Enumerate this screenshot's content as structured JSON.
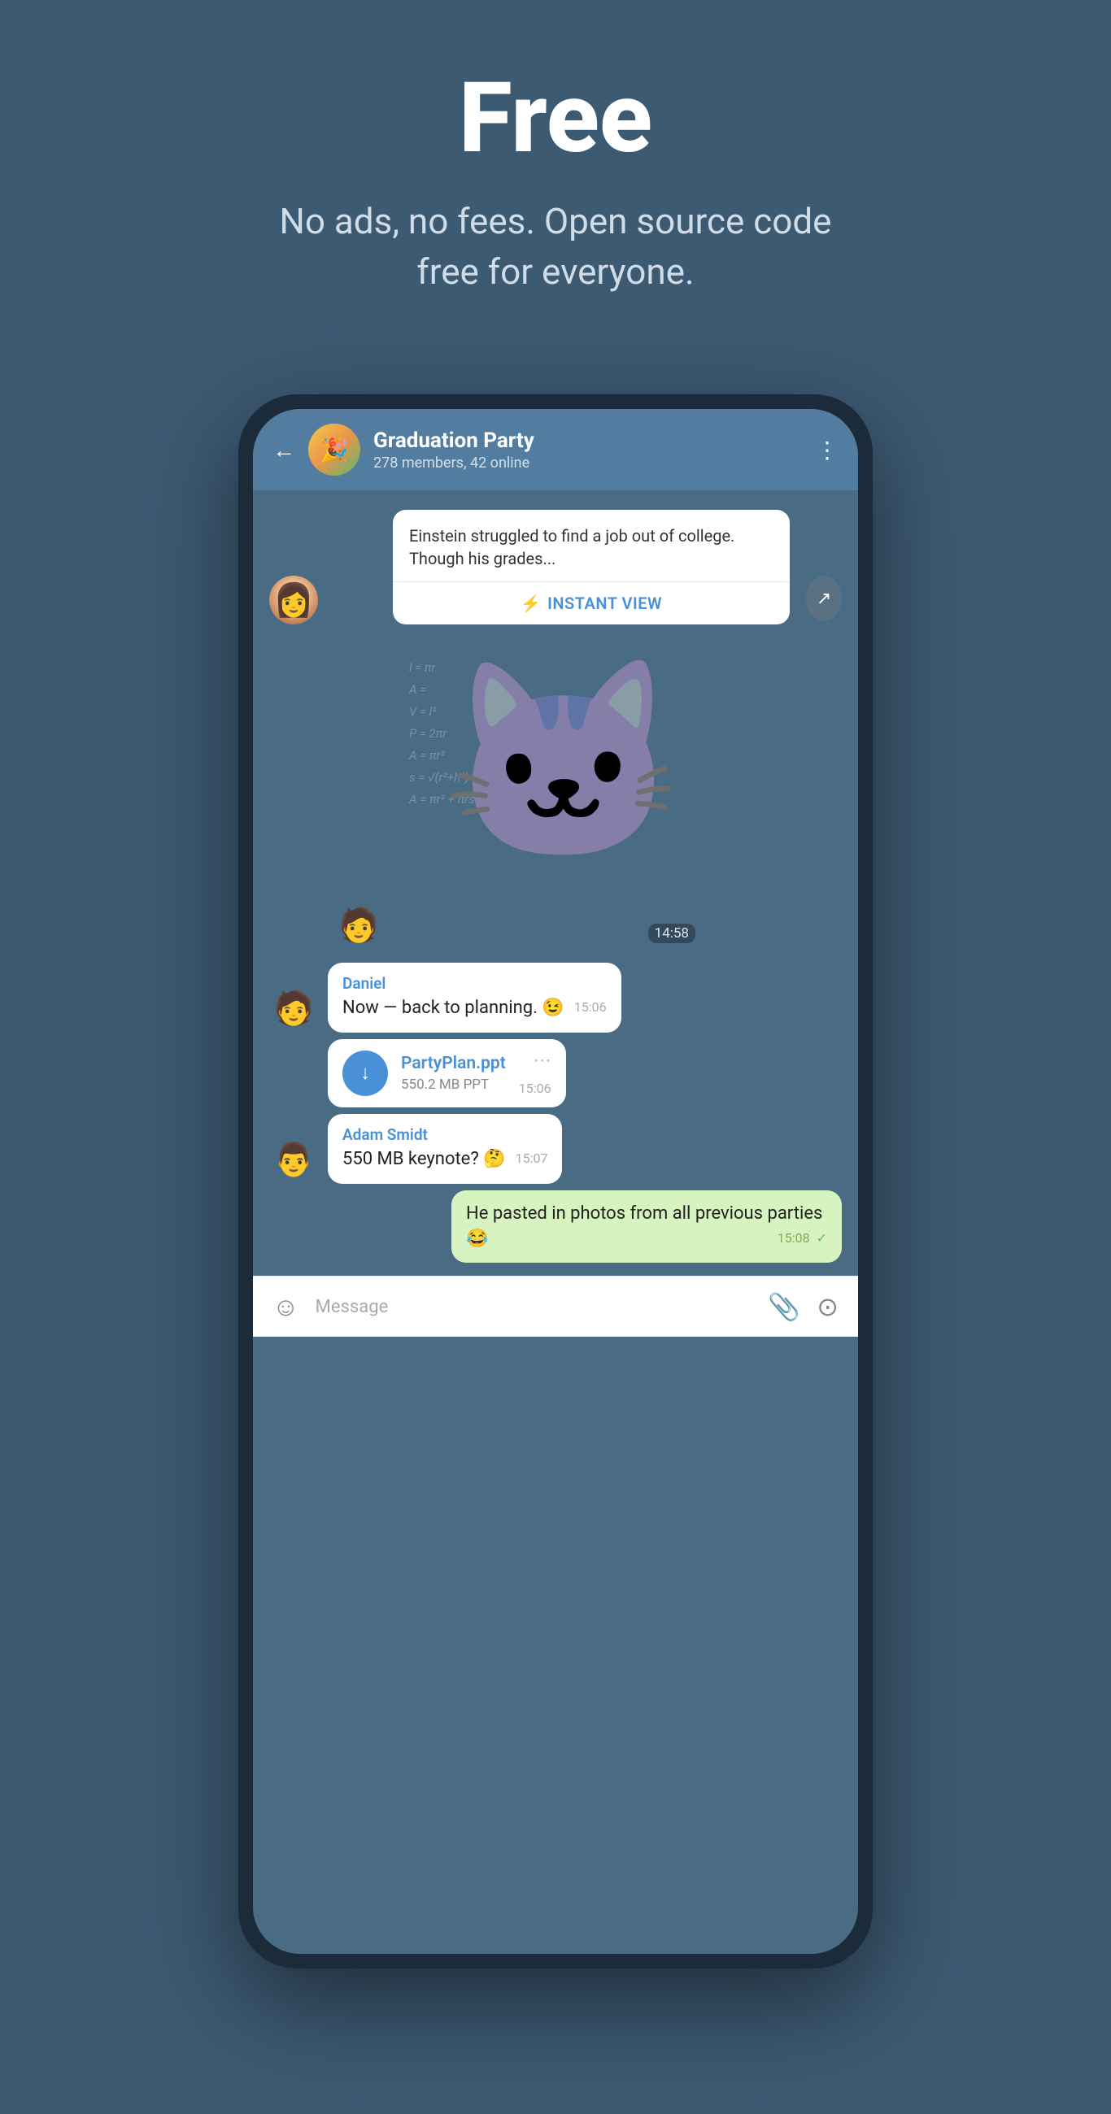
{
  "hero": {
    "title": "Free",
    "subtitle": "No ads, no fees. Open source code free for everyone."
  },
  "chat": {
    "header": {
      "back_label": "←",
      "group_name": "Graduation Party",
      "group_meta": "278 members, 42 online",
      "more_icon": "⋮"
    },
    "article": {
      "text": "Einstein struggled to find a job out of college. Though his grades...",
      "instant_view_label": "INSTANT VIEW"
    },
    "sticker": {
      "time": "14:58"
    },
    "messages": [
      {
        "sender": "Daniel",
        "text": "Now — back to planning. 😉",
        "time": "15:06",
        "type": "received"
      },
      {
        "type": "file",
        "filename": "PartyPlan.ppt",
        "filesize": "550.2 MB PPT",
        "time": "15:06"
      },
      {
        "sender": "Adam Smidt",
        "text": "550 MB keynote? 🤔",
        "time": "15:07",
        "type": "received"
      },
      {
        "text": "He pasted in photos from all previous parties 😂",
        "time": "15:08",
        "type": "sent",
        "checkmark": "✓"
      }
    ],
    "bottom_bar": {
      "placeholder": "Message",
      "emoji_icon": "☺",
      "attach_icon": "📎",
      "camera_icon": "⊙"
    }
  }
}
